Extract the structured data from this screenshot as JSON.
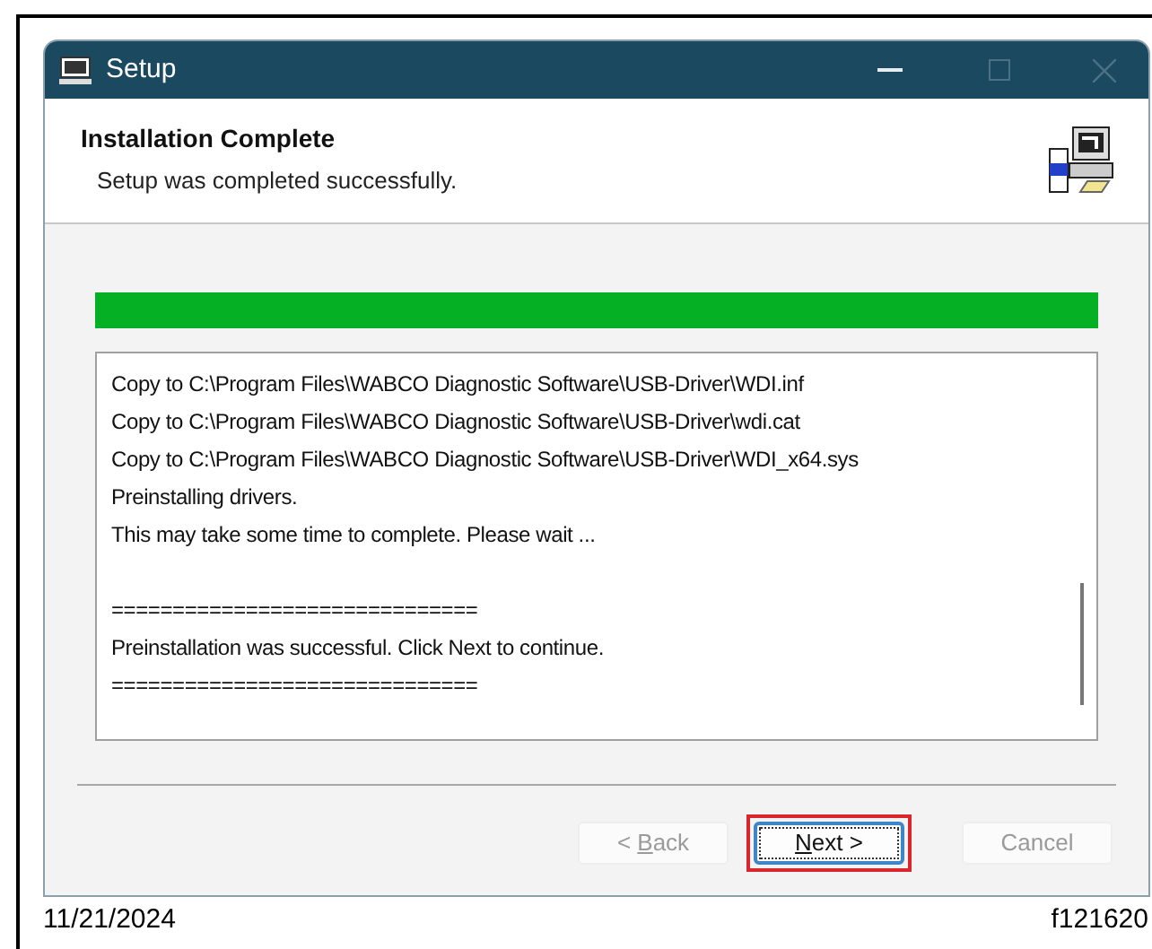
{
  "window": {
    "title": "Setup"
  },
  "header": {
    "title": "Installation Complete",
    "subtitle": "Setup was completed successfully."
  },
  "progress": {
    "level": 1
  },
  "log": {
    "lines": [
      "Copy to C:\\Program Files\\WABCO Diagnostic Software\\USB-Driver\\WDI.inf",
      "Copy to C:\\Program Files\\WABCO Diagnostic Software\\USB-Driver\\wdi.cat",
      "Copy to C:\\Program Files\\WABCO Diagnostic Software\\USB-Driver\\WDI_x64.sys",
      "Preinstalling drivers.",
      "This may take some time to complete. Please wait ...",
      {
        "text": "==============================",
        "gap_before": true
      },
      "Preinstallation was successful. Click Next to continue.",
      "=============================="
    ]
  },
  "buttons": [
    {
      "before_key": "< ",
      "access_key": "B",
      "after_key": "ack",
      "disabled": true,
      "highlighted": false
    },
    {
      "access_key": "N",
      "after_key": "ext >",
      "disabled": false,
      "highlighted": true
    },
    {
      "label": "Cancel",
      "disabled": true,
      "highlighted": false
    }
  ],
  "caption": {
    "date": "11/21/2024",
    "figure_id": "f121620"
  }
}
